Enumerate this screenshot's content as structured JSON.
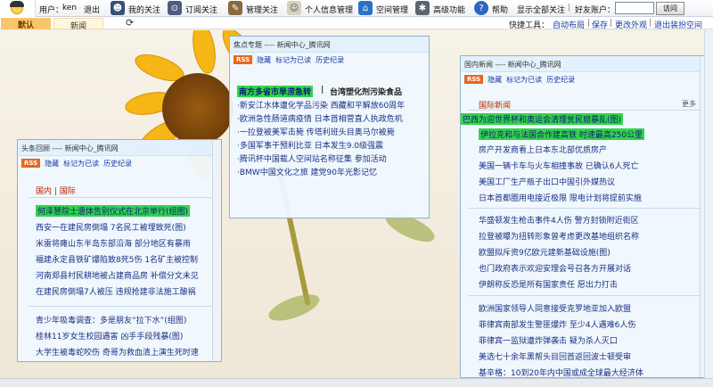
{
  "toolbar": {
    "user_label": "用户：",
    "user_name": "ken",
    "logout": "退出",
    "my_follow": "我的关注",
    "subscribe": "订阅关注",
    "manage_follow": "管理关注",
    "profile": "个人信息管理",
    "space_manage": "空间管理",
    "advanced": "高级功能",
    "help": "帮助",
    "show_all": "显示全部关注",
    "friend_label": "好友账户：",
    "visit": "访问"
  },
  "tabs": {
    "default": "默认",
    "news": "新闻"
  },
  "quicklinks": {
    "label": "快捷工具：",
    "auto_layout": "自动布局",
    "save": "保存",
    "change_look": "更改外观",
    "exit_manage": "退出装扮空间"
  },
  "panel_tools": {
    "rss": "RSS",
    "hide": "隐藏",
    "mark_read": "标记为已读",
    "history": "历史纪录"
  },
  "focus_panel": {
    "title": "焦点专题 ---- 新闻中心_腾讯网",
    "highlight": "南方多省市旱涝急转",
    "divider": "|",
    "headline2": "台湾塑化剂污染食品",
    "items": [
      "·新安江水体遭化学品污染 西藏和平解放60周年",
      "·欧洲急性肠道病疫情 日本首相菅直人执政危机",
      "·一拉登被美军击毙 传塔利班头目奥马尔被毙",
      "·多国军事干预利比亚 日本发生9.0级强震",
      "·腾讯杯中国载人空间站名称征集 参加活动",
      "·BMW中国文化之旅 建党90年光影记忆"
    ]
  },
  "headline_panel": {
    "title": "头条回顾 ---- 新闻中心_腾讯网",
    "sections": "国内  |  国际",
    "items": [
      "何泽慧院士遗体告别仪式在北京举行(组图)",
      "西安一在建民房倒塌 7名民工被埋致死(图)",
      "米雷将瘫山东半岛东部沿海 部分地区有暴雨",
      "福建永定县铁矿爆陷致8死5伤 1名矿主被控制",
      "河南郑县村民耕地被占建商品房 补偿分文未见",
      "在建民房倒塌7人被压 违规抢建非法施工酿祸",
      "青少年吸毒调查：多是朋友“拉下水”(组图)",
      "桂林11岁女生校园遇害 凶手手段残暴(图)",
      "大学生被毒蛇咬伤 奇哥为救血清上演生死时速"
    ]
  },
  "intl_panel": {
    "title": "国内新闻 ---- 新闻中心_腾讯网",
    "section": "国际新闻",
    "more": "更多",
    "items": [
      "巴西为迎世界杯和奥运会清理贫民窟暴乱(图)",
      "伊拉克和与法国合作建高铁 时速最高250公里",
      "房产开发商看上日本东北部优质房产",
      "美国一辆卡车与火车相撞事故 已确认6人死亡",
      "美国工厂生产瓶子出口中国引外媒热议",
      "日本首都圈用电接近极限 限电计划将提前实施",
      "华盛顿发生枪击事件4人伤 警方封锁附近街区",
      "拉登被曝为扭转形象曾考虑更改基地组织名称",
      "欧盟拟斥资9亿欧元建新基础设施(图)",
      "也门政府表示欢迎安理会号召各方开展对话",
      "伊朗称反恐是所有国家责任 愿出力打击",
      "欧洲国家领导人同意接受克罗地亚加入欧盟",
      "菲律宾南部发生警匪爆炸 至少4人遇难6人伤",
      "菲律宾一监狱遭炸弹袭击 疑为杀人灭口",
      "美选七十余年黑帮头目回首返回波士顿受审",
      "基辛格：10到20年内中国或成全球最大经济体"
    ]
  }
}
